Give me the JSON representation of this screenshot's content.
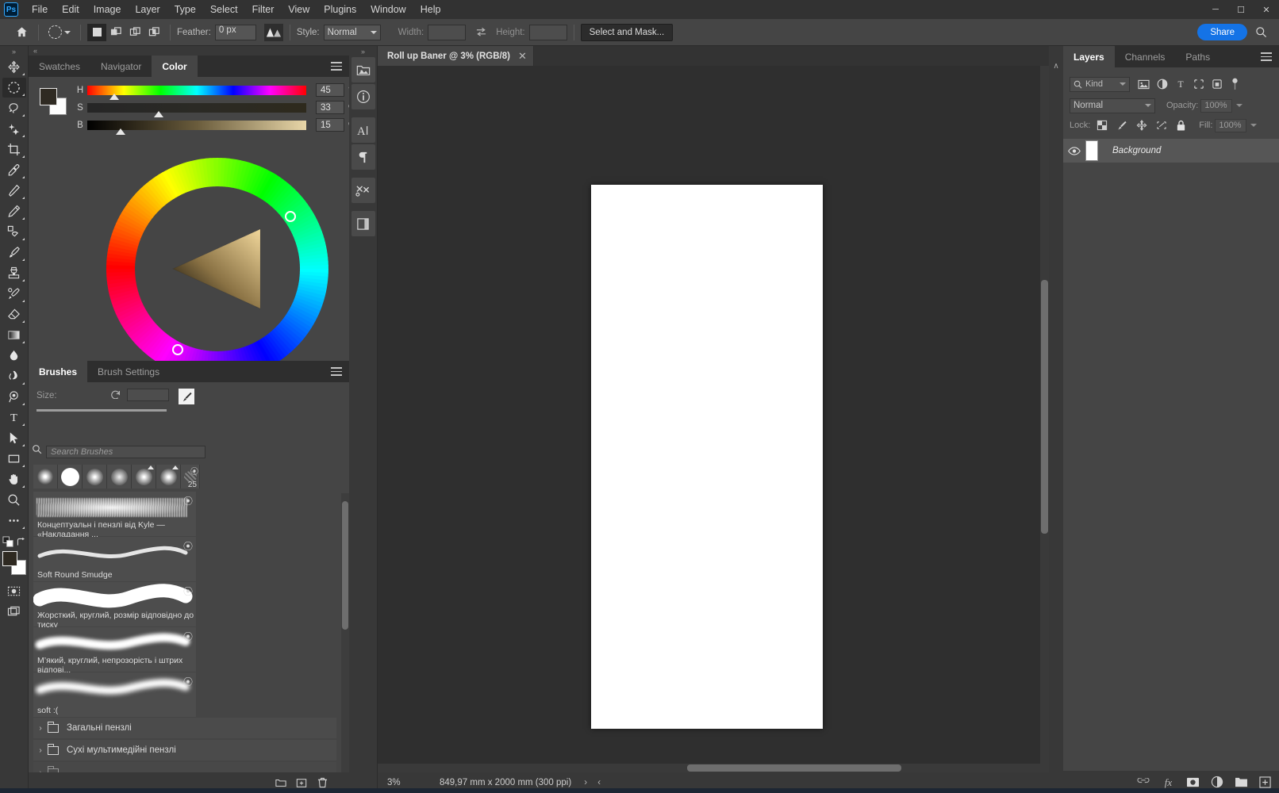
{
  "app": {
    "logo": "Ps",
    "menus": [
      "File",
      "Edit",
      "Image",
      "Layer",
      "Type",
      "Select",
      "Filter",
      "View",
      "Plugins",
      "Window",
      "Help"
    ],
    "window_controls": {
      "minimize": "─",
      "maximize": "☐",
      "close": "✕"
    }
  },
  "options_bar": {
    "home_icon": "home-icon",
    "tool_preset": "elliptical-marquee",
    "modes": [
      "new-selection",
      "add-to-selection",
      "subtract-from-selection",
      "intersect-with-selection"
    ],
    "feather_label": "Feather:",
    "feather_value": "0 px",
    "antialias_icon": "anti-alias-icon",
    "style_label": "Style:",
    "style_value": "Normal",
    "width_label": "Width:",
    "width_value": "",
    "swap_icon": "swap-arrows-icon",
    "height_label": "Height:",
    "height_value": "",
    "select_and_mask": "Select and Mask...",
    "share": "Share",
    "search_icon": "search-icon"
  },
  "toolbar": {
    "expand_icon": "»",
    "tools": [
      {
        "name": "move-tool",
        "active": false
      },
      {
        "name": "elliptical-marquee-tool",
        "active": true
      },
      {
        "name": "lasso-tool",
        "active": false
      },
      {
        "name": "object-selection-tool",
        "active": false
      },
      {
        "name": "crop-tool",
        "active": false
      },
      {
        "name": "eyedropper-tool",
        "active": false
      },
      {
        "name": "spot-healing-brush-tool",
        "active": false
      },
      {
        "name": "brush-tool",
        "active": false
      },
      {
        "name": "clone-stamp-tool",
        "active": false
      },
      {
        "name": "history-brush-tool",
        "active": false
      },
      {
        "name": "eraser-tool",
        "active": false
      },
      {
        "name": "gradient-tool",
        "active": false
      },
      {
        "name": "blur-tool",
        "active": false
      },
      {
        "name": "dodge-tool",
        "active": false
      },
      {
        "name": "pen-tool",
        "active": false
      },
      {
        "name": "type-tool",
        "active": false
      },
      {
        "name": "path-selection-tool",
        "active": false
      },
      {
        "name": "rectangle-tool",
        "active": false
      },
      {
        "name": "hand-tool",
        "active": false
      },
      {
        "name": "zoom-tool",
        "active": false
      },
      {
        "name": "edit-toolbar-tool",
        "active": false
      }
    ],
    "foreground_color": "#2f2a22",
    "background_color": "#ffffff",
    "quickmask_icon": "quick-mask-icon",
    "screenmode_icon": "screen-mode-icon"
  },
  "color_panel": {
    "tabs": [
      {
        "label": "Swatches",
        "active": false
      },
      {
        "label": "Navigator",
        "active": false
      },
      {
        "label": "Color",
        "active": true
      }
    ],
    "menu_icon": "panel-menu-icon",
    "sliders": [
      {
        "label": "H",
        "value": "45",
        "unit": "°",
        "pos_pct": 13
      },
      {
        "label": "S",
        "value": "33",
        "unit": "%",
        "pos_pct": 33
      },
      {
        "label": "B",
        "value": "15",
        "unit": "%",
        "pos_pct": 15
      }
    ],
    "wheel_icon": "color-wheel",
    "expand_icon": "expand-panel-icon"
  },
  "brushes_panel": {
    "tabs": [
      {
        "label": "Brushes",
        "active": true
      },
      {
        "label": "Brush Settings",
        "active": false
      }
    ],
    "menu_icon": "panel-menu-icon",
    "size_label": "Size:",
    "size_value": "",
    "reset_icon": "reset-icon",
    "brush-preview-icon": "brush-preview-icon",
    "search_placeholder": "Search Brushes",
    "tip_count_label": "25",
    "brush_items": [
      {
        "name": "Концептуальн і пензлі від Kyle — «Накладання ...",
        "style": "gritty"
      },
      {
        "name": "Soft Round Smudge",
        "style": "thin-soft"
      },
      {
        "name": "Жорсткий, круглий, розмір відповідно до тиску",
        "style": "hard-thick"
      },
      {
        "name": "М’який, круглий, непрозорість і штрих відпові...",
        "style": "soft-mid"
      },
      {
        "name": "soft :(",
        "style": "soft-blur"
      }
    ],
    "folders": [
      {
        "label": "Загальні пензлі"
      },
      {
        "label": "Сухі мультимедійні пензлі"
      }
    ],
    "footer_icons": [
      "new-group-icon",
      "new-brush-icon",
      "delete-brush-icon"
    ]
  },
  "icon_rail": {
    "expand_icon": "»",
    "icons": [
      "libraries-icon",
      "info-icon",
      "character-icon",
      "paragraph-icon",
      "adjustments-icon",
      "layer-comps-icon"
    ]
  },
  "document": {
    "tab_title": "Roll up Baner @ 3% (RGB/8)",
    "close_icon": "✕",
    "zoom": "3%",
    "dimensions": "849,97 mm x 2000 mm (300 ppi)",
    "status_arrows": "›  ‹"
  },
  "layers_panel": {
    "tabs": [
      {
        "label": "Layers",
        "active": true
      },
      {
        "label": "Channels",
        "active": false
      },
      {
        "label": "Paths",
        "active": false
      }
    ],
    "menu_icon": "panel-menu-icon",
    "kind_label": "Kind",
    "kind_filter_icons": [
      "pixel-filter-icon",
      "adjustment-filter-icon",
      "type-filter-icon",
      "shape-filter-icon",
      "smart-object-filter-icon"
    ],
    "filter_toggle_icon": "filter-toggle-icon",
    "blend_mode": "Normal",
    "opacity_label": "Opacity:",
    "opacity_value": "100%",
    "lock_label": "Lock:",
    "lock_icons": [
      "lock-transparent-icon",
      "lock-image-icon",
      "lock-position-icon",
      "lock-artboard-icon",
      "lock-all-icon"
    ],
    "fill_label": "Fill:",
    "fill_value": "100%",
    "layers": [
      {
        "name": "Background",
        "visible": true,
        "thumb": "#ffffff"
      }
    ],
    "footer_icons": [
      "link-layers-icon",
      "fx-icon",
      "add-mask-icon",
      "adjustment-layer-icon",
      "new-group-icon",
      "new-layer-icon"
    ]
  },
  "colors": {
    "accent": "#1473e6",
    "panel_bg": "#454545",
    "dock_bg": "#383838",
    "canvas_bg": "#2f2f2f",
    "page": "#ffffff"
  }
}
